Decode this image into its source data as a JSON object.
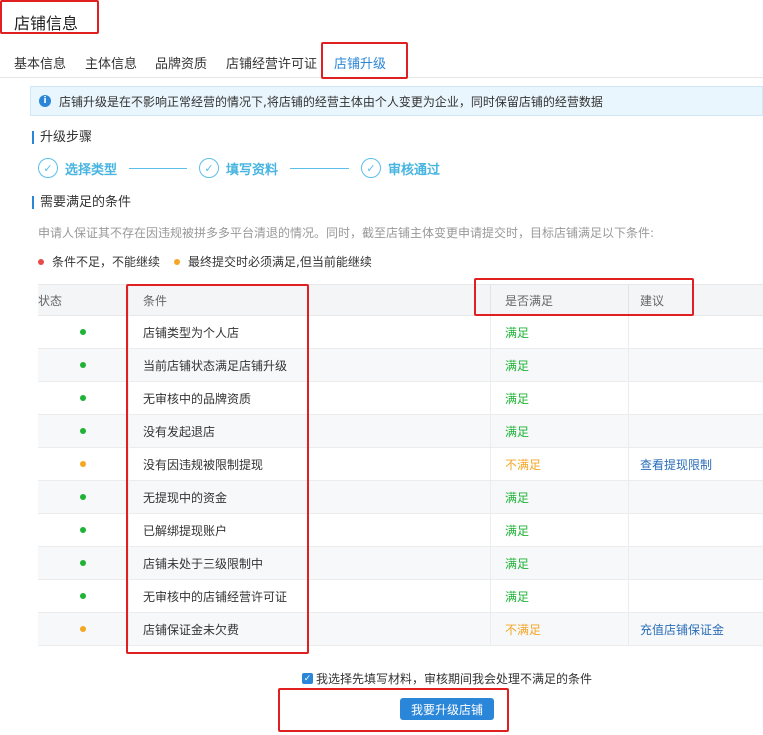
{
  "page": {
    "title": "店铺信息"
  },
  "tabs": [
    {
      "label": "基本信息"
    },
    {
      "label": "主体信息"
    },
    {
      "label": "品牌资质"
    },
    {
      "label": "店铺经营许可证"
    },
    {
      "label": "店铺升级"
    }
  ],
  "notice": {
    "text": "店铺升级是在不影响正常经营的情况下,将店铺的经营主体由个人变更为企业，同时保留店铺的经营数据"
  },
  "steps_section": {
    "title": "升级步骤"
  },
  "steps": [
    {
      "label": "选择类型"
    },
    {
      "label": "填写资料"
    },
    {
      "label": "审核通过"
    }
  ],
  "conditions_section": {
    "title": "需要满足的条件",
    "description": "申请人保证其不存在因违规被拼多多平台清退的情况。同时，截至店铺主体变更申请提交时，目标店铺满足以下条件:"
  },
  "legend": {
    "red": "条件不足，不能继续",
    "orange": "最终提交时必须满足,但当前能继续"
  },
  "table": {
    "headers": {
      "status": "状态",
      "condition": "条件",
      "met": "是否满足",
      "suggestion": "建议"
    },
    "rows": [
      {
        "status": "green",
        "condition": "店铺类型为个人店",
        "met": "满足",
        "suggestion": ""
      },
      {
        "status": "green",
        "condition": "当前店铺状态满足店铺升级",
        "met": "满足",
        "suggestion": ""
      },
      {
        "status": "green",
        "condition": "无审核中的品牌资质",
        "met": "满足",
        "suggestion": ""
      },
      {
        "status": "green",
        "condition": "没有发起退店",
        "met": "满足",
        "suggestion": ""
      },
      {
        "status": "orange",
        "condition": "没有因违规被限制提现",
        "met": "不满足",
        "suggestion": "查看提现限制"
      },
      {
        "status": "green",
        "condition": "无提现中的资金",
        "met": "满足",
        "suggestion": ""
      },
      {
        "status": "green",
        "condition": "已解绑提现账户",
        "met": "满足",
        "suggestion": ""
      },
      {
        "status": "green",
        "condition": "店铺未处于三级限制中",
        "met": "满足",
        "suggestion": ""
      },
      {
        "status": "green",
        "condition": "无审核中的店铺经营许可证",
        "met": "满足",
        "suggestion": ""
      },
      {
        "status": "orange",
        "condition": "店铺保证金未欠费",
        "met": "不满足",
        "suggestion": "充值店铺保证金"
      }
    ]
  },
  "agreement": {
    "label": "我选择先填写材料，审核期间我会处理不满足的条件",
    "checked": true
  },
  "submit": {
    "label": "我要升级店铺"
  },
  "colors": {
    "accent": "#2a86d9",
    "ok": "#1eb336",
    "warn": "#f5a623",
    "error": "#e84a4a",
    "annotation": "#e02020"
  }
}
